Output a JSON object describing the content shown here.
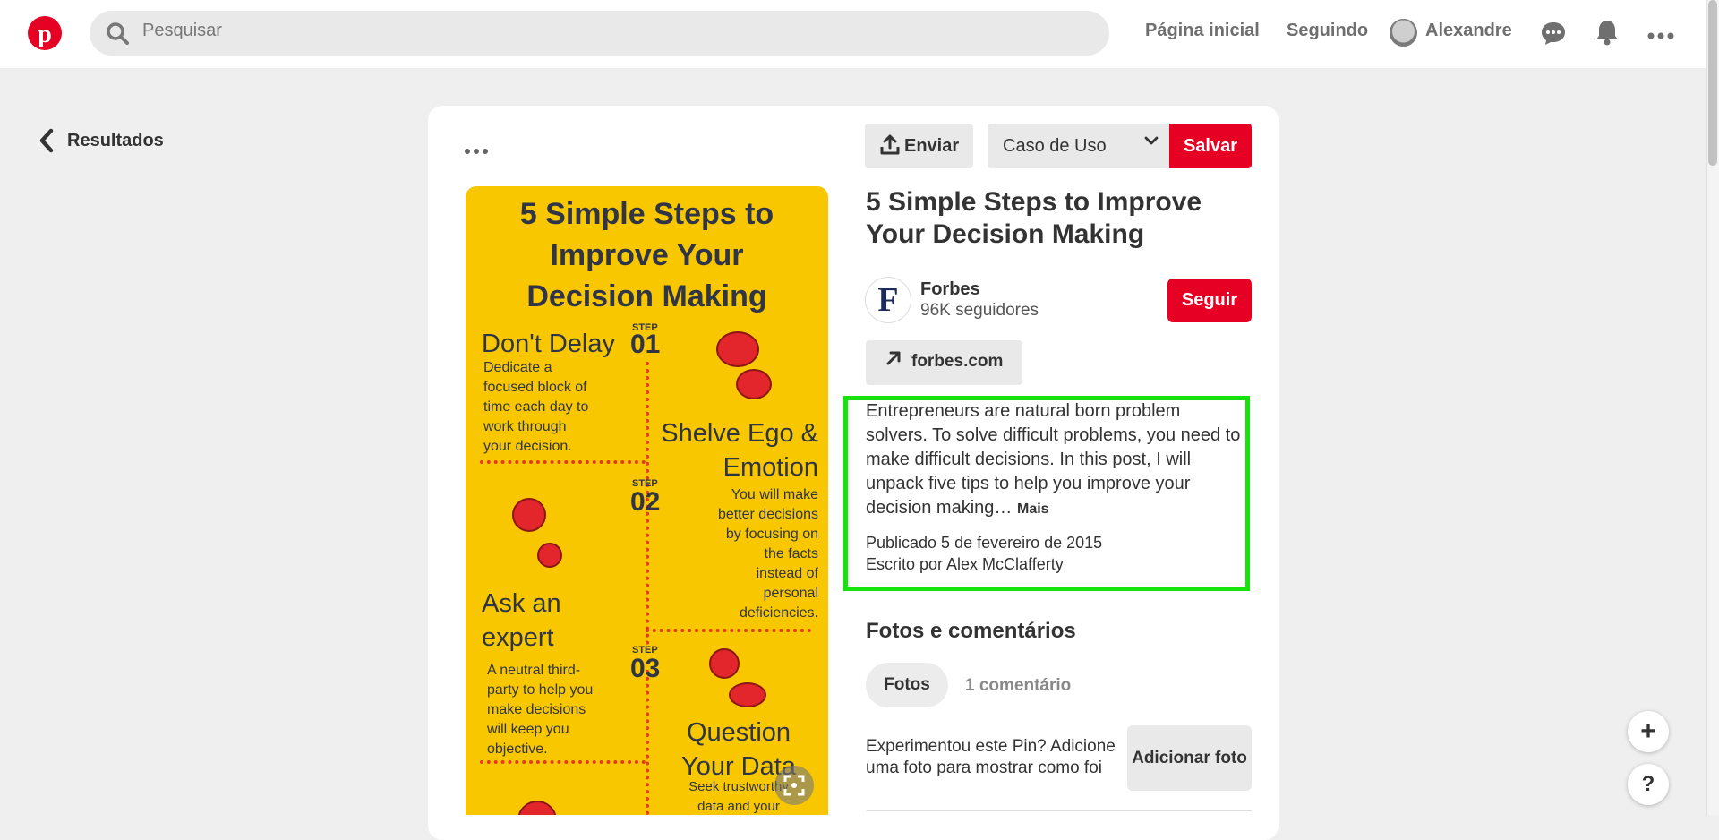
{
  "header": {
    "search_placeholder": "Pesquisar",
    "nav_home": "Página inicial",
    "nav_following": "Seguindo",
    "user_name": "Alexandre"
  },
  "back": {
    "label": "Resultados"
  },
  "toolbar": {
    "send_label": "Enviar",
    "board_value": "Caso de Uso",
    "save_label": "Salvar"
  },
  "infographic": {
    "title_line1": "5 Simple Steps to",
    "title_line2": "Improve Your",
    "title_line3": "Decision Making",
    "step_word": "STEP",
    "step1_num": "01",
    "step1_title": "Don't Delay",
    "step1_text": [
      "Dedicate a",
      "focused block of",
      "time each day to",
      "work through",
      "your decision."
    ],
    "step2_num": "02",
    "step2_title_line1": "Shelve Ego &",
    "step2_title_line2": "Emotion",
    "step2_text": [
      "You will make",
      "better decisions",
      "by focusing on",
      "the facts",
      "instead of",
      "personal",
      "deficiencies."
    ],
    "step3_num": "03",
    "ask_line1": "Ask an",
    "ask_line2": "expert",
    "ask_text": [
      "A neutral third-",
      "party to help you",
      "make decisions",
      "will keep you",
      "objective."
    ],
    "question_line1": "Question",
    "question_line2": "Your Data",
    "question_text": [
      "Seek trustworthy",
      "data and your"
    ]
  },
  "pin": {
    "title": "5 Simple Steps to Improve Your Decision Making",
    "source_name": "Forbes",
    "source_followers": "96K seguidores",
    "follow_label": "Seguir",
    "link_label": "forbes.com",
    "description": "Entrepreneurs are natural born problem solvers. To solve difficult problems, you need to make difficult decisions. In this post, I will unpack five tips to help you improve your decision making…",
    "more_label": "Mais",
    "published": "Publicado 5 de fevereiro de 2015",
    "written_by": "Escrito por Alex McClafferty",
    "logo_letter": "F"
  },
  "comments": {
    "section_title": "Fotos e comentários",
    "tab_photos": "Fotos",
    "tab_comments": "1 comentário",
    "try_text": "Experimentou este Pin? Adicione uma foto para mostrar como foi",
    "add_photo_label": "Adicionar foto"
  },
  "fab": {
    "plus": "+",
    "help": "?"
  },
  "colors": {
    "brand_red": "#e60023",
    "highlight_green": "#16e30c",
    "infographic_yellow": "#f8c700"
  }
}
